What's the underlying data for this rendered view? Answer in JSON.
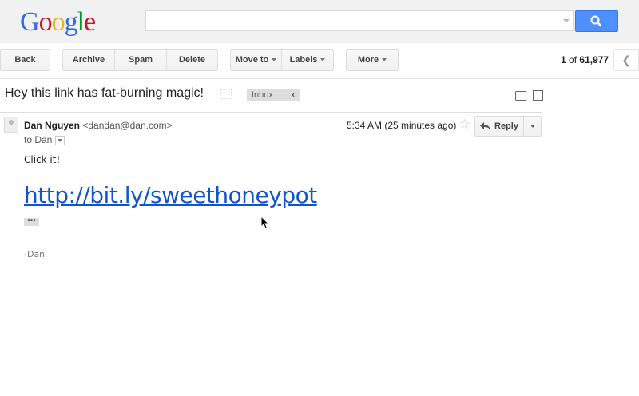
{
  "header": {
    "logo_text": "Google",
    "search": {
      "value": "",
      "placeholder": ""
    }
  },
  "toolbar": {
    "back": "Back",
    "archive": "Archive",
    "spam": "Spam",
    "delete": "Delete",
    "move_to": "Move to",
    "labels": "Labels",
    "more": "More",
    "counter_current": "1",
    "counter_of": "of",
    "counter_total": "61,977"
  },
  "message": {
    "subject": "Hey this link has fat-burning magic!",
    "label": "Inbox",
    "label_remove": "x",
    "sender_name": "Dan Nguyen",
    "sender_email": "<dandan@dan.com>",
    "to_line": "to Dan",
    "time": "5:34 AM (25 minutes ago)",
    "reply_label": "Reply",
    "body_line": "Click it!",
    "link_text": "http://bit.ly/sweethoneypot",
    "ellipsis": "•••",
    "signature": "-Dan"
  },
  "colors": {
    "accent_blue": "#4d90fe",
    "link": "#1155cc"
  }
}
